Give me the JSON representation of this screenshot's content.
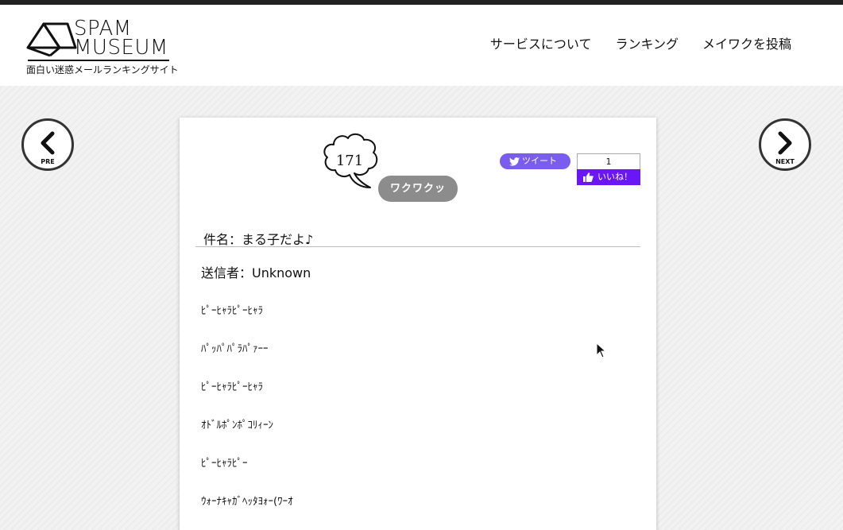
{
  "header": {
    "logo_line1": "SPAM",
    "logo_line2": "MUSEUM",
    "tagline": "面白い迷惑メールランキングサイト",
    "nav": [
      {
        "label": "サービスについて"
      },
      {
        "label": "ランキング"
      },
      {
        "label": "メイワクを投稿"
      }
    ]
  },
  "pager": {
    "prev_label": "PRE",
    "next_label": "NEXT"
  },
  "post": {
    "waku_count": "171",
    "waku_button": "ワクワクッ",
    "tweet_label": "ツイート",
    "like_count": "1",
    "like_label": "いいね！",
    "subject": "件名：まる子だよ♪",
    "sender": "送信者：Unknown",
    "body": [
      "ﾋﾟｰﾋｬﾗﾋﾟｰﾋｬﾗ",
      "ﾊﾟｯﾊﾟﾊﾟﾗﾊﾟｧｰｰ",
      "ﾋﾟｰﾋｬﾗﾋﾟｰﾋｬﾗ",
      "ｵﾄﾞﾙﾎﾟﾝﾎﾟｺﾘｨｰﾝ",
      "ﾋﾟｰﾋｬﾗﾋﾟｰ",
      "ｳｫｰﾅｷｬｶﾞﾍｯﾀﾖｫｰ(ﾜｰｵ"
    ]
  },
  "colors": {
    "tweet": "#7b5cf0",
    "like": "#6a16f5",
    "waku": "#8c8c8c",
    "topbar": "#222222"
  }
}
